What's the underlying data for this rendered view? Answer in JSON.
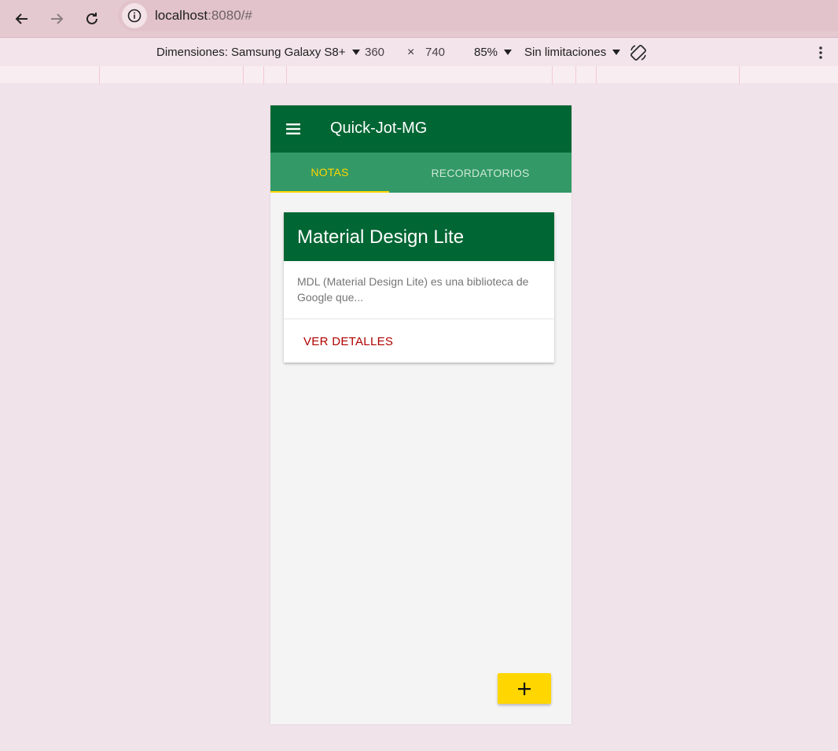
{
  "browser": {
    "url_host": "localhost",
    "url_rest": ":8080/#"
  },
  "device_toolbar": {
    "device_label": "Dimensiones: Samsung Galaxy S8+",
    "width": "360",
    "times": "×",
    "height": "740",
    "zoom": "85%",
    "throttling": "Sin limitaciones"
  },
  "app": {
    "title": "Quick-Jot-MG",
    "tabs": [
      {
        "label": "NOTAS",
        "active": true
      },
      {
        "label": "RECORDATORIOS",
        "active": false
      }
    ],
    "cards": [
      {
        "title": "Material Design Lite",
        "text": "MDL (Material Design Lite) es una biblioteca de Google que...",
        "action": "VER DETALLES"
      }
    ],
    "fab_icon": "plus-icon"
  },
  "colors": {
    "primary": "#006633",
    "tab_bar": "#339966",
    "accent": "#ffd600",
    "action_text": "#b00000"
  }
}
